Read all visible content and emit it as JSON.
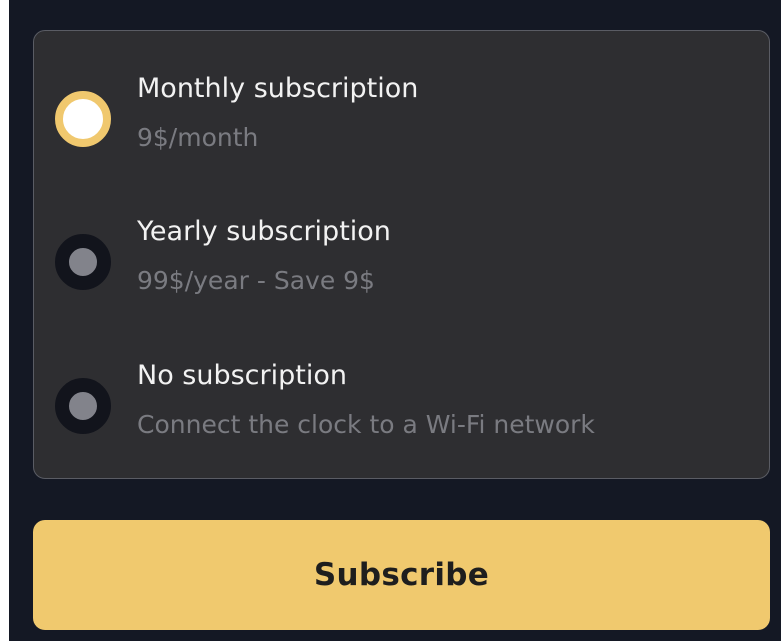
{
  "plans": [
    {
      "title": "Monthly subscription",
      "subtitle": "9$/month",
      "selected": true
    },
    {
      "title": "Yearly subscription",
      "subtitle": "99$/year - Save 9$",
      "selected": false
    },
    {
      "title": "No subscription",
      "subtitle": "Connect the clock to a Wi-Fi network",
      "selected": false
    }
  ],
  "subscribe_label": "Subscribe",
  "colors": {
    "background": "#141824",
    "card": "#2e2e31",
    "accent": "#f0c96e",
    "radio_unselected": "#82838b",
    "title_text": "#f2f2f2",
    "subtitle_text": "#7a7b81"
  }
}
